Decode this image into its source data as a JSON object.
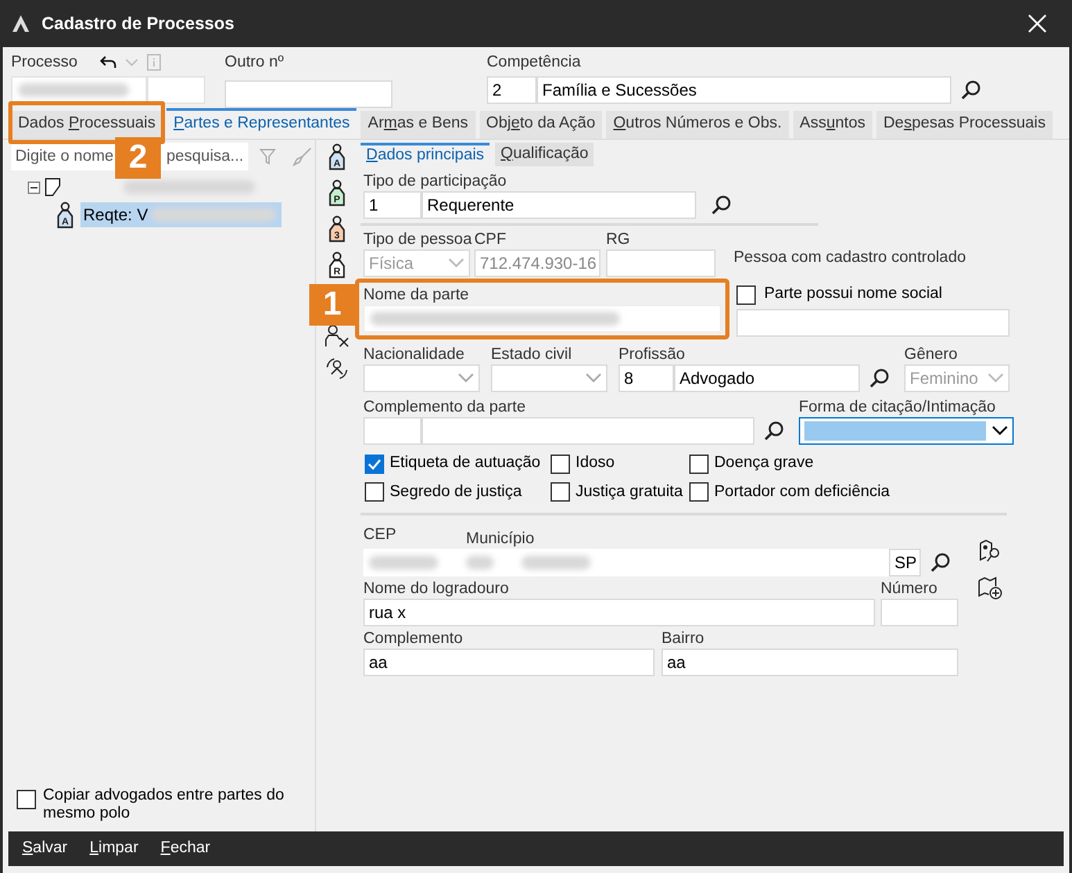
{
  "window": {
    "title": "Cadastro de Processos"
  },
  "header": {
    "processo": {
      "label": "Processo"
    },
    "outro": {
      "label": "Outro nº"
    },
    "competencia": {
      "label": "Competência",
      "code": "2",
      "value": "Família e Sucessões"
    }
  },
  "tabs": [
    {
      "parts": {
        "pre": "Dados ",
        "key": "P",
        "post": "rocessuais"
      },
      "selected": false,
      "annotation": "2"
    },
    {
      "parts": {
        "key": "P",
        "post": "artes e Representantes"
      },
      "selected": true
    },
    {
      "parts": {
        "pre": "Ar",
        "key": "m",
        "post": "as e Bens"
      },
      "selected": false
    },
    {
      "parts": {
        "pre": "Obj",
        "key": "e",
        "post": "to da Ação"
      },
      "selected": false
    },
    {
      "parts": {
        "key": "O",
        "post": "utros Números e Obs."
      },
      "selected": false
    },
    {
      "parts": {
        "pre": "Ass",
        "key": "u",
        "post": "ntos"
      },
      "selected": false
    },
    {
      "parts": {
        "pre": "De",
        "key": "s",
        "post": "pesas Processuais"
      },
      "selected": false
    }
  ],
  "party_list": {
    "search": {
      "placeholder_start": "Digite o nome",
      "placeholder_end": "pesquisa..."
    },
    "tree": [
      {
        "kind": "process",
        "expanded": true,
        "children": [
          {
            "kind": "party",
            "letter": "A",
            "label": "Reqte: V",
            "selected": true
          }
        ]
      }
    ]
  },
  "side_tools": [
    {
      "kind": "tag",
      "letter": "A",
      "color": "#cfe2f3"
    },
    {
      "kind": "tag",
      "letter": "P",
      "color": "#c6efce"
    },
    {
      "kind": "tag",
      "letter": "3",
      "color": "#f8cbad"
    },
    {
      "kind": "tag",
      "letter": "R",
      "color": "#ffffff"
    },
    {
      "kind": "remove"
    },
    {
      "kind": "swap"
    }
  ],
  "subtabs": [
    {
      "parts": {
        "key": "D",
        "post": "ados principais"
      },
      "selected": true
    },
    {
      "parts": {
        "key": "Q",
        "post": "ualificação"
      },
      "selected": false
    }
  ],
  "tipo_participacao": {
    "label": "Tipo de participação",
    "code": "1",
    "value": "Requerente"
  },
  "tipo_pessoa": {
    "label": "Tipo de pessoa",
    "value": "Física",
    "disabled": true
  },
  "cpf": {
    "label": "CPF",
    "value": "712.474.930-16",
    "disabled": true
  },
  "rg": {
    "label": "RG"
  },
  "controlled_note": "Pessoa com cadastro controlado",
  "nome_parte": {
    "label": "Nome da parte",
    "annotation": "1"
  },
  "nome_social": {
    "label": "Parte possui nome social",
    "checked": false
  },
  "nacionalidade": {
    "label": "Nacionalidade"
  },
  "estado_civil": {
    "label": "Estado civil"
  },
  "profissao": {
    "label": "Profissão",
    "code": "8",
    "value": "Advogado"
  },
  "genero": {
    "label": "Gênero",
    "value": "Feminino",
    "disabled": true
  },
  "complemento_parte": {
    "label": "Complemento da parte"
  },
  "forma_citacao": {
    "label": "Forma de citação/Intimação",
    "focused": true
  },
  "flags": [
    {
      "label": "Etiqueta de autuação",
      "checked": true
    },
    {
      "label": "Idoso",
      "checked": false
    },
    {
      "label": "Doença grave",
      "checked": false
    },
    {
      "label": "Segredo de justiça",
      "checked": false
    },
    {
      "label": "Justiça gratuita",
      "checked": false
    },
    {
      "label": "Portador com deficiência",
      "checked": false
    }
  ],
  "address": {
    "cep": {
      "label": "CEP"
    },
    "municipio": {
      "label": "Município",
      "uf": "SP"
    },
    "logradouro": {
      "label": "Nome do logradouro",
      "value": "rua x"
    },
    "numero": {
      "label": "Número"
    },
    "complemento": {
      "label": "Complemento",
      "value": "aa"
    },
    "bairro": {
      "label": "Bairro",
      "value": "aa"
    }
  },
  "copy_lawyers": {
    "label": "Copiar advogados entre partes do mesmo polo",
    "checked": false
  },
  "footer_buttons": [
    {
      "parts": {
        "key": "S",
        "post": "alvar"
      }
    },
    {
      "parts": {
        "key": "L",
        "post": "impar"
      }
    },
    {
      "parts": {
        "key": "F",
        "post": "echar"
      }
    }
  ]
}
